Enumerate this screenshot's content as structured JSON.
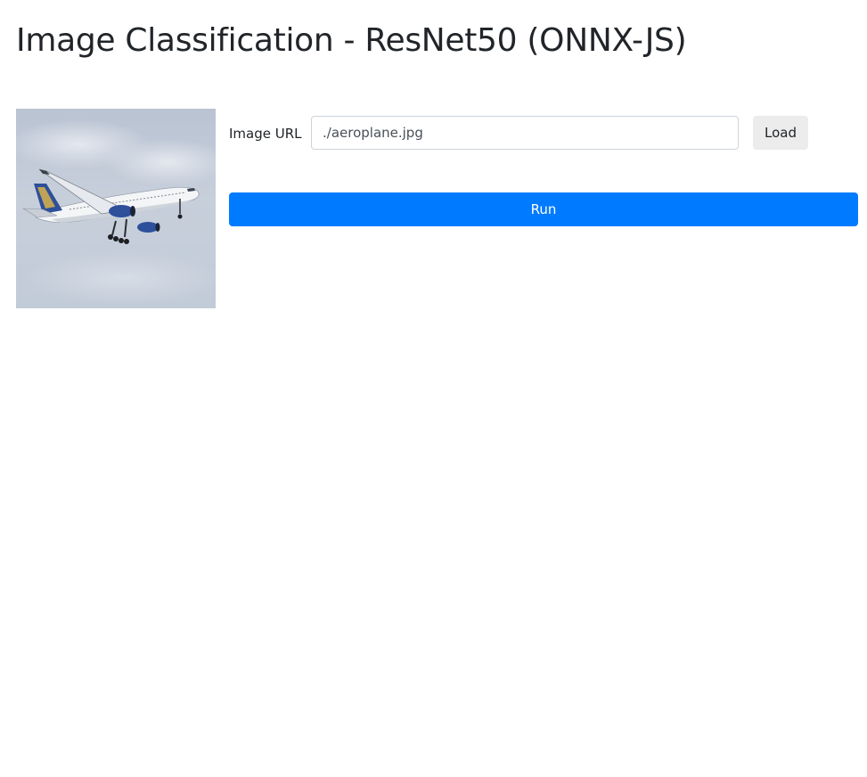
{
  "header": {
    "title": "Image Classification - ResNet50 (ONNX-JS)"
  },
  "preview": {
    "subject": "aeroplane-photo"
  },
  "form": {
    "url_label": "Image URL",
    "url_value": "./aeroplane.jpg",
    "load_label": "Load",
    "run_label": "Run"
  },
  "colors": {
    "primary": "#007bff",
    "secondary_button": "#ececec",
    "text": "#212529"
  }
}
